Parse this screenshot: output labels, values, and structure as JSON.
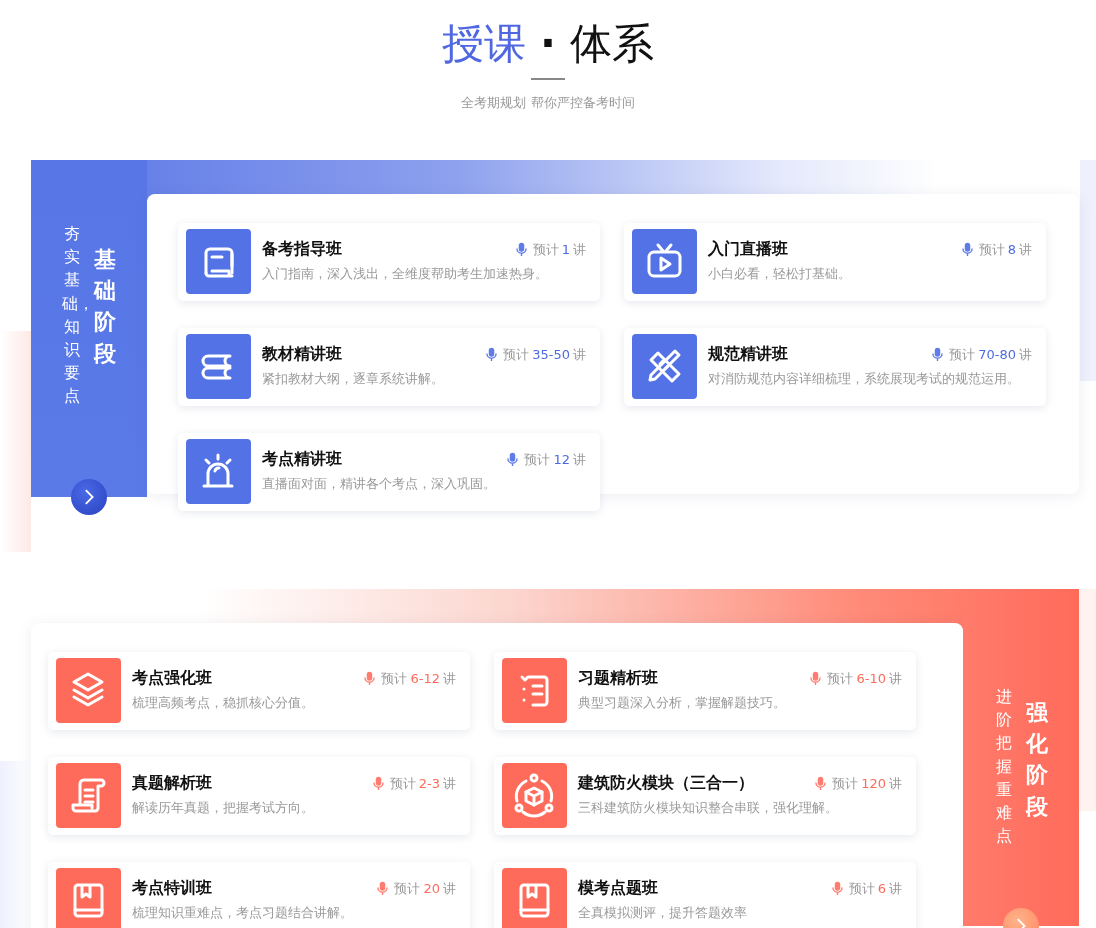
{
  "header": {
    "title_highlight": "授课",
    "title_separator": "·",
    "title_rest": "体系",
    "subtitle": "全考期规划 帮你严控备考时间"
  },
  "stages": [
    {
      "kind": "foundation",
      "name": "基础阶段",
      "slogan": "夯实基础，知识要点",
      "courses": [
        {
          "title": "备考指导班",
          "desc": "入门指南，深入浅出，全维度帮助考生加速热身。",
          "count": {
            "prefix": "预计",
            "number": "1",
            "unit": "讲"
          }
        },
        {
          "title": "入门直播班",
          "desc": "小白必看，轻松打基础。",
          "count": {
            "prefix": "预计",
            "number": "8",
            "unit": "讲"
          }
        },
        {
          "title": "教材精讲班",
          "desc": "紧扣教材大纲，逐章系统讲解。",
          "count": {
            "prefix": "预计",
            "number": "35-50",
            "unit": "讲"
          }
        },
        {
          "title": "规范精讲班",
          "desc": "对消防规范内容详细梳理，系统展现考试的规范运用。",
          "count": {
            "prefix": "预计",
            "number": "70-80",
            "unit": "讲"
          }
        },
        {
          "title": "考点精讲班",
          "desc": "直播面对面，精讲各个考点，深入巩固。",
          "count": {
            "prefix": "预计",
            "number": "12",
            "unit": "讲"
          }
        }
      ]
    },
    {
      "kind": "advanced",
      "name": "强化阶段",
      "slogan": "进阶把握重难点",
      "courses": [
        {
          "title": "考点强化班",
          "desc": "梳理高频考点，稳抓核心分值。",
          "count": {
            "prefix": "预计",
            "number": "6-12",
            "unit": "讲"
          }
        },
        {
          "title": "习题精析班",
          "desc": "典型习题深入分析，掌握解题技巧。",
          "count": {
            "prefix": "预计",
            "number": "6-10",
            "unit": "讲"
          }
        },
        {
          "title": "真题解析班",
          "desc": "解读历年真题，把握考试方向。",
          "count": {
            "prefix": "预计",
            "number": "2-3",
            "unit": "讲"
          }
        },
        {
          "title": "建筑防火模块（三合一）",
          "desc": "三科建筑防火模块知识整合串联，强化理解。",
          "count": {
            "prefix": "预计",
            "number": "120",
            "unit": "讲"
          }
        },
        {
          "title": "考点特训班",
          "desc": "梳理知识重难点，考点习题结合讲解。",
          "count": {
            "prefix": "预计",
            "number": "20",
            "unit": "讲"
          }
        },
        {
          "title": "模考点题班",
          "desc": "全真模拟测评，提升答题效率",
          "count": {
            "prefix": "预计",
            "number": "6",
            "unit": "讲"
          }
        }
      ]
    }
  ]
}
